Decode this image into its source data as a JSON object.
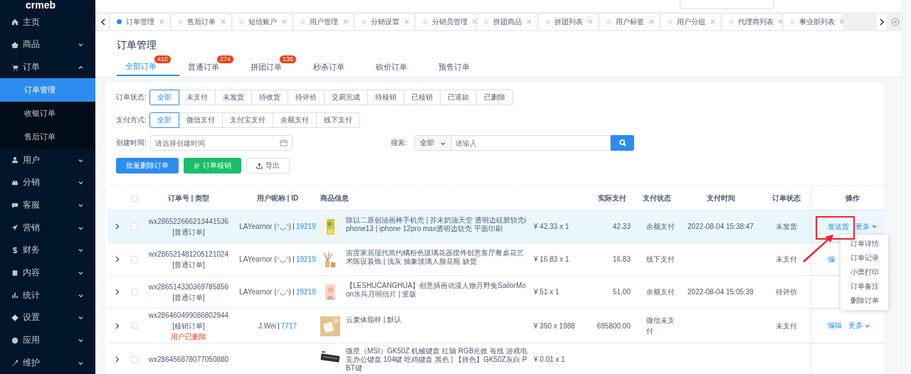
{
  "logo": "crmeb",
  "sidebar": {
    "items": [
      {
        "label": "主页",
        "kind": "link"
      },
      {
        "label": "商品",
        "kind": "group",
        "expanded": false
      },
      {
        "label": "订单",
        "kind": "group",
        "expanded": true,
        "children": [
          {
            "label": "订单管理",
            "selected": true
          },
          {
            "label": "收银订单",
            "selected": false
          },
          {
            "label": "售后订单",
            "selected": false
          }
        ]
      },
      {
        "label": "用户",
        "kind": "group",
        "expanded": false
      },
      {
        "label": "分销",
        "kind": "group",
        "expanded": false
      },
      {
        "label": "客服",
        "kind": "group",
        "expanded": false
      },
      {
        "label": "营销",
        "kind": "group",
        "expanded": false
      },
      {
        "label": "财务",
        "kind": "group",
        "expanded": false
      },
      {
        "label": "内容",
        "kind": "group",
        "expanded": false
      },
      {
        "label": "统计",
        "kind": "group",
        "expanded": false
      },
      {
        "label": "设置",
        "kind": "group",
        "expanded": false
      },
      {
        "label": "应用",
        "kind": "group",
        "expanded": false
      },
      {
        "label": "维护",
        "kind": "group",
        "expanded": false
      }
    ]
  },
  "tags_view": {
    "tabs": [
      {
        "label": "订单管理",
        "selected": true
      },
      {
        "label": "售后订单",
        "selected": false
      },
      {
        "label": "短信账户",
        "selected": false
      },
      {
        "label": "用户管理",
        "selected": false
      },
      {
        "label": "分销设置",
        "selected": false
      },
      {
        "label": "分销员管理",
        "selected": false
      },
      {
        "label": "拼团商品",
        "selected": false
      },
      {
        "label": "拼团列表",
        "selected": false
      },
      {
        "label": "用户标签",
        "selected": false
      },
      {
        "label": "用户分组",
        "selected": false
      },
      {
        "label": "代理商列表",
        "selected": false
      },
      {
        "label": "事业部列表",
        "selected": false
      }
    ]
  },
  "page_header": {
    "title": "订单管理",
    "tabs": [
      {
        "label": "全部订单",
        "badge": "410",
        "selected": true
      },
      {
        "label": "普通订单",
        "badge": "274",
        "selected": false
      },
      {
        "label": "拼团订单",
        "badge": "136",
        "selected": false
      },
      {
        "label": "秒杀订单",
        "selected": false
      },
      {
        "label": "砍价订单",
        "selected": false
      },
      {
        "label": "预售订单",
        "selected": false
      }
    ]
  },
  "filters": {
    "order_status": {
      "label": "订单状态:",
      "options": [
        {
          "label": "全部",
          "selected": true
        },
        {
          "label": "未支付",
          "selected": false
        },
        {
          "label": "未发货",
          "selected": false
        },
        {
          "label": "待收货",
          "selected": false
        },
        {
          "label": "待评价",
          "selected": false
        },
        {
          "label": "交易完成",
          "selected": false
        },
        {
          "label": "待核销",
          "selected": false
        },
        {
          "label": "已核销",
          "selected": false
        },
        {
          "label": "已退款",
          "selected": false
        },
        {
          "label": "已删除",
          "selected": false
        }
      ]
    },
    "payment_method": {
      "label": "支付方式:",
      "options": [
        {
          "label": "全部",
          "selected": true
        },
        {
          "label": "微信支付",
          "selected": false
        },
        {
          "label": "支付宝支付",
          "selected": false
        },
        {
          "label": "余额支付",
          "selected": false
        },
        {
          "label": "线下支付",
          "selected": false
        }
      ]
    },
    "created_time": {
      "label": "创建时间:",
      "placeholder": "请选择创建时间"
    },
    "search": {
      "label": "搜索:",
      "scope": "全部",
      "placeholder": "请输入"
    }
  },
  "actions": [
    {
      "label": "批量删除订单",
      "kind": "primary"
    },
    {
      "label": "订单核销",
      "kind": "success"
    },
    {
      "label": "导出",
      "kind": "default"
    }
  ],
  "table": {
    "header_checked": false,
    "columns": [
      "订单号 | 类型",
      "用户昵称 | ID",
      "商品信息",
      "实际支付",
      "支付状态",
      "支付时间",
      "订单状态",
      "操作"
    ],
    "rows": [
      {
        "order_no": "wx286522666213441536",
        "type": "[普通订单]",
        "user": "LAYearnor (◜◡◝)",
        "user_id": "19219",
        "product": "除以二原创油画棒手机壳 | 芥末奶油天空 透明边硅胶软壳iphone13 | iphone 12pro max透明边软壳 平面印刷",
        "price": "¥ 42.33 x 1",
        "paid": "42.33",
        "pay_status": "余额支付",
        "pay_time": "2022-08-04 15:38:47",
        "status": "未发货",
        "ops": [
          "发送货",
          "更多"
        ],
        "selected": true,
        "checked": false,
        "expanded": false
      },
      {
        "order_no": "wx286521481205121024",
        "type": "[普通订单]",
        "user": "LAYearnor (◜◡◝)",
        "user_id": "19219",
        "product": "宙度家居现代简约橘粉色玻璃花器摆件创意客厅餐桌花艺术陈设装饰 | 浅灰 抽象玻璃人脸花瓶 缺货",
        "price": "¥ 16.83 x 1",
        "paid": "16.83",
        "pay_status": "线下支付",
        "status": "未支付",
        "ops": [
          "编"
        ],
        "selected": false,
        "checked": false,
        "expanded": false
      },
      {
        "order_no": "wx286514330369785856",
        "type": "[普通订单]",
        "user": "LAYearnor (◜◡◝)",
        "user_id": "19219",
        "product": "【LESHUCANGHUA】创意插画动漫人物月野兔SailorMoon水兵月明信片 | 竖版",
        "price": "¥ 51 x 1",
        "paid": "51.00",
        "pay_status": "余额支付",
        "pay_time": "2022-08-04 15:05:39",
        "status": "待评价",
        "selected": false,
        "checked": false,
        "expanded": false
      },
      {
        "order_no": "wx286460499086802944",
        "type": "[核销订单]",
        "note": "用户已删除",
        "user": "J.Wei",
        "user_id": "7717",
        "product": "云麦体脂秤 | 默认",
        "price": "¥ 350 x 1988",
        "paid": "695800.00",
        "pay_status": "微信未支付",
        "status": "未支付",
        "ops": [
          "编辑",
          "更多"
        ],
        "selected": false,
        "checked": false,
        "expanded": false
      },
      {
        "order_no": "wx286456878077050880",
        "product": "微星（MSI）GK50Z 机械键盘 红轴 RGB光效 有线 游戏电竞办公键盘 104键 吃鸡键盘 黑色 | 【拼色】GK50Z灰白 PBT键",
        "price": "¥ 0.01 x 1",
        "selected": false,
        "checked": false,
        "expanded": false
      }
    ]
  },
  "dropdown": {
    "items": [
      "订单详情",
      "订单记录",
      "小票打印",
      "订单备注",
      "删除订单"
    ]
  }
}
